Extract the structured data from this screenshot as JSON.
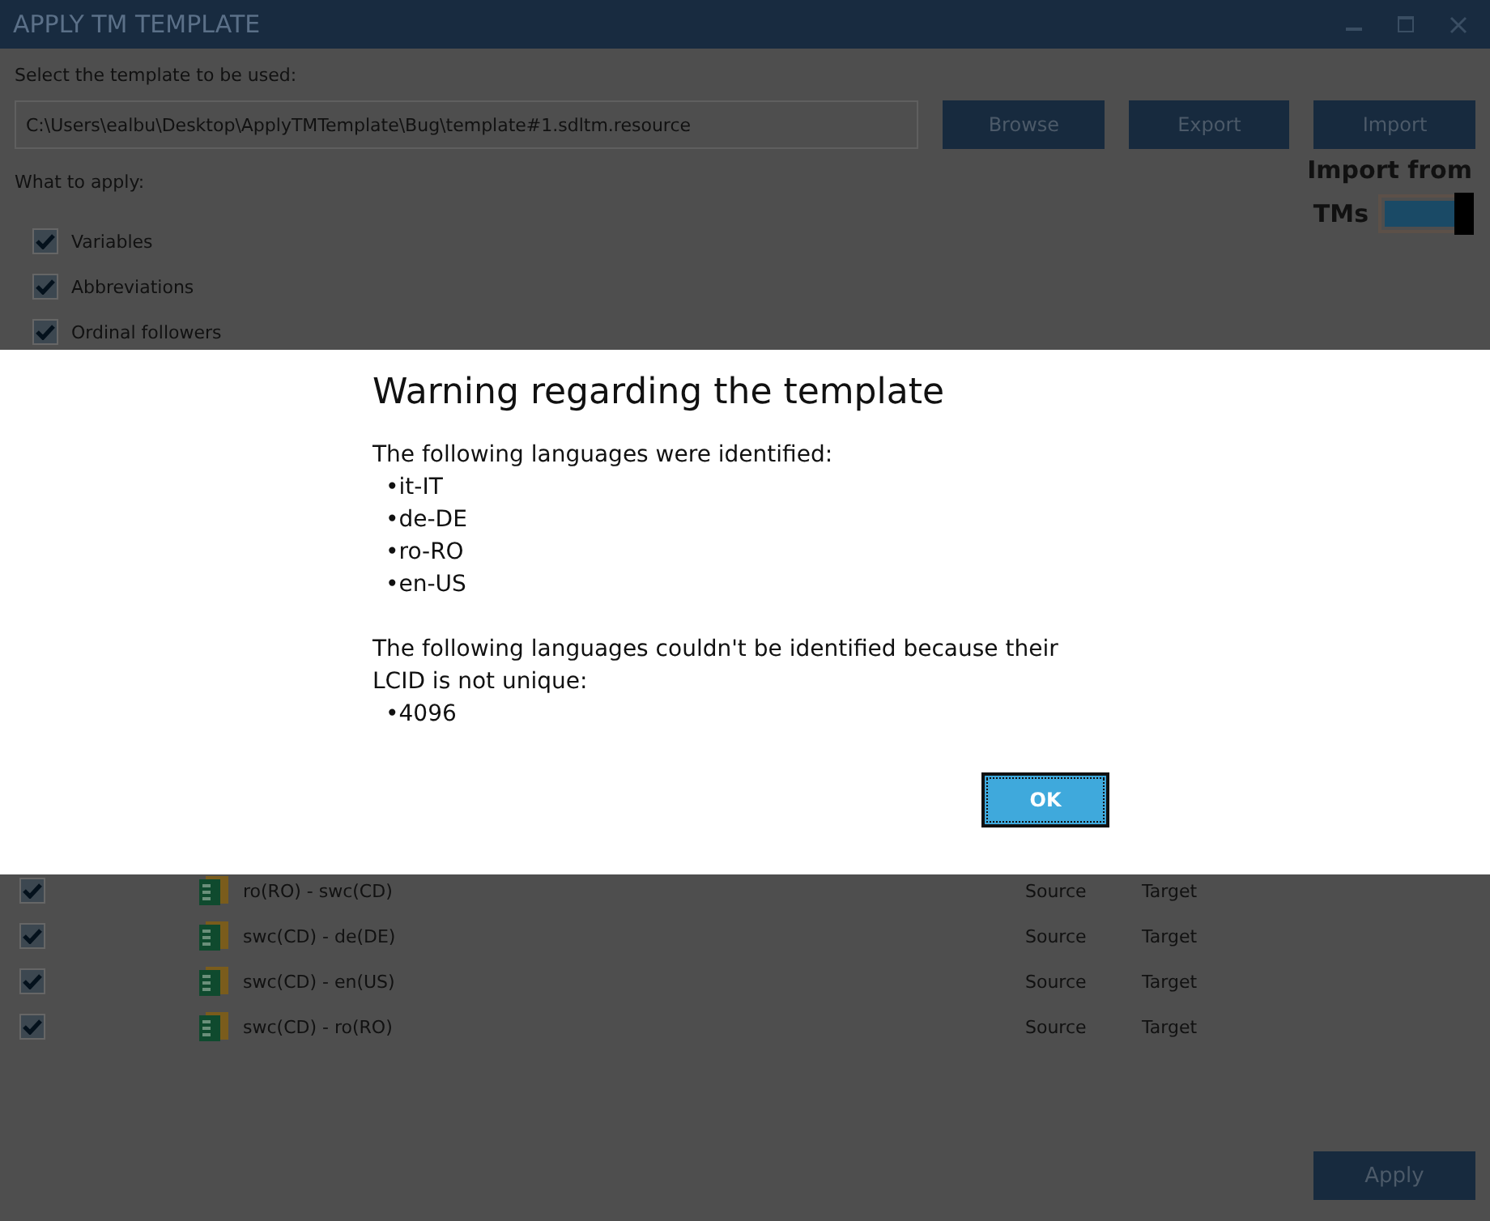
{
  "window": {
    "title": "APPLY TM TEMPLATE"
  },
  "template_label": "Select the template to be used:",
  "template_path": {
    "value": "C:\\Users\\ealbu\\Desktop\\ApplyTMTemplate\\Bug\\template#1.sdltm.resource"
  },
  "buttons": [
    {
      "label": "Browse"
    },
    {
      "label": "Export"
    },
    {
      "label": "Import"
    }
  ],
  "import_from_tms": {
    "label_1": "Import from",
    "label_2": "TMs",
    "on": true
  },
  "what_to_apply_label": "What to apply:",
  "options": [
    {
      "label": "Variables",
      "checked": true
    },
    {
      "label": "Abbreviations",
      "checked": true
    },
    {
      "label": "Ordinal followers",
      "checked": true
    }
  ],
  "tm_rows": [
    {
      "name": "ro(RO) - swc(CD)",
      "checked": true,
      "source": "Source",
      "target": "Target"
    },
    {
      "name": "swc(CD) - de(DE)",
      "checked": true,
      "source": "Source",
      "target": "Target"
    },
    {
      "name": "swc(CD) - en(US)",
      "checked": true,
      "source": "Source",
      "target": "Target"
    },
    {
      "name": "swc(CD) - ro(RO)",
      "checked": true,
      "source": "Source",
      "target": "Target"
    }
  ],
  "apply_button": "Apply",
  "dialog": {
    "title": "Warning regarding the template",
    "identified_label": "The following languages were identified:",
    "identified": [
      "•it-IT",
      "•de-DE",
      "•ro-RO",
      "•en-US"
    ],
    "unidentified_label": "The following languages couldn't be identified because their LCID is not unique:",
    "unidentified": [
      "•4096"
    ],
    "ok_button": "OK"
  }
}
